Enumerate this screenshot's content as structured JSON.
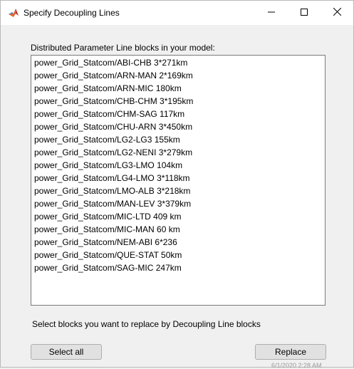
{
  "window": {
    "title": "Specify Decoupling Lines",
    "app_icon": "matlab-icon",
    "controls": {
      "minimize_icon": "minimize-icon",
      "maximize_icon": "maximize-icon",
      "close_icon": "close-icon"
    }
  },
  "main": {
    "list_label": "Distributed Parameter Line blocks in your model:",
    "items": [
      "power_Grid_Statcom/ABI-CHB 3*271km",
      "power_Grid_Statcom/ARN-MAN 2*169km",
      "power_Grid_Statcom/ARN-MIC 180km",
      "power_Grid_Statcom/CHB-CHM 3*195km",
      "power_Grid_Statcom/CHM-SAG 117km",
      "power_Grid_Statcom/CHU-ARN 3*450km",
      "power_Grid_Statcom/LG2-LG3 155km",
      "power_Grid_Statcom/LG2-NENI 3*279km",
      "power_Grid_Statcom/LG3-LMO 104km",
      "power_Grid_Statcom/LG4-LMO 3*118km",
      "power_Grid_Statcom/LMO-ALB 3*218km",
      "power_Grid_Statcom/MAN-LEV 3*379km",
      "power_Grid_Statcom/MIC-LTD 409 km",
      "power_Grid_Statcom/MIC-MAN 60 km",
      "power_Grid_Statcom/NEM-ABI 6*236",
      "power_Grid_Statcom/QUE-STAT 50km",
      "power_Grid_Statcom/SAG-MIC 247km"
    ],
    "instruction": "Select blocks you want to replace by Decoupling Line blocks"
  },
  "buttons": {
    "select_all": "Select all",
    "replace": "Replace"
  },
  "background": {
    "peek_text": "6/1/2020 2:28 AM"
  }
}
